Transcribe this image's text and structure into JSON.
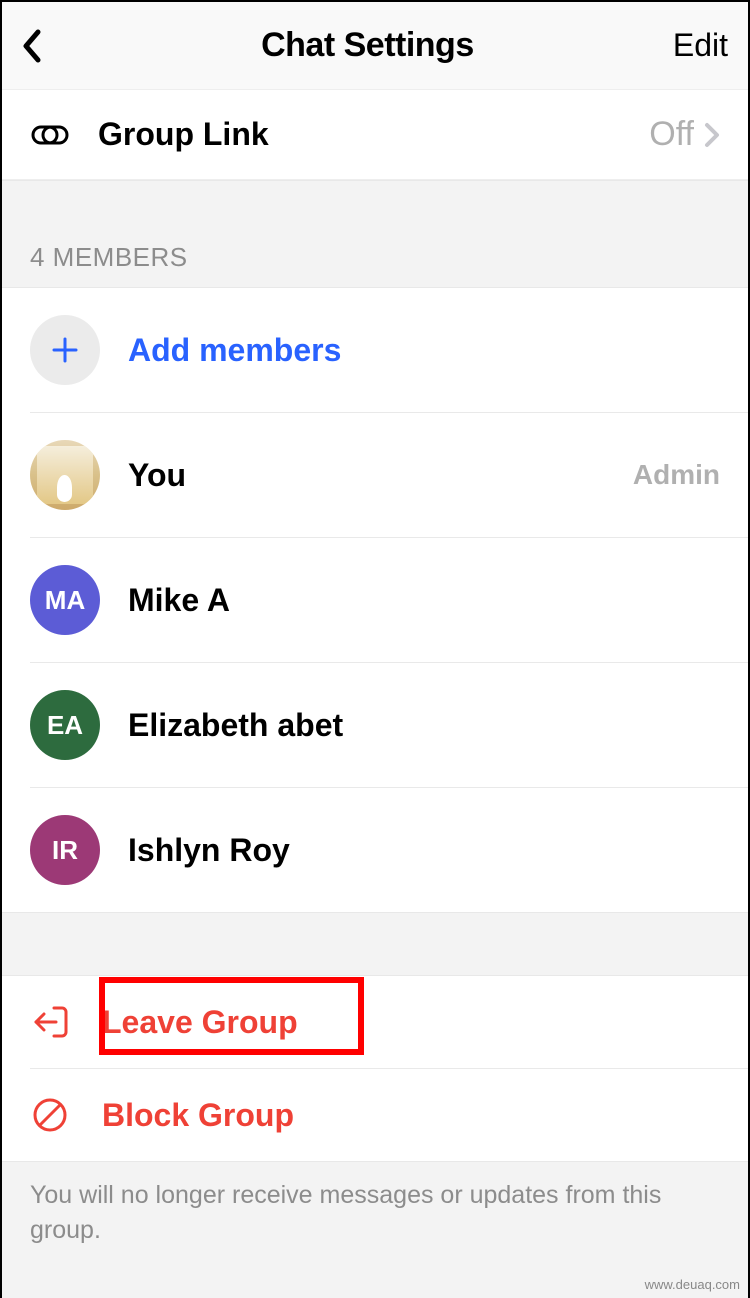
{
  "header": {
    "title": "Chat Settings",
    "edit_label": "Edit"
  },
  "group_link": {
    "label": "Group Link",
    "value": "Off"
  },
  "members_section": {
    "header": "4 MEMBERS",
    "add_label": "Add members",
    "members": [
      {
        "name": "You",
        "initials": "",
        "role": "Admin",
        "avatar_type": "image"
      },
      {
        "name": "Mike A",
        "initials": "MA",
        "role": "",
        "avatar_type": "ma"
      },
      {
        "name": "Elizabeth abet",
        "initials": "EA",
        "role": "",
        "avatar_type": "ea"
      },
      {
        "name": "Ishlyn Roy",
        "initials": "IR",
        "role": "",
        "avatar_type": "ir"
      }
    ]
  },
  "actions": {
    "leave_label": "Leave Group",
    "block_label": "Block Group"
  },
  "footer": {
    "note": "You will no longer receive messages or updates from this group."
  },
  "watermark": "www.deuaq.com"
}
